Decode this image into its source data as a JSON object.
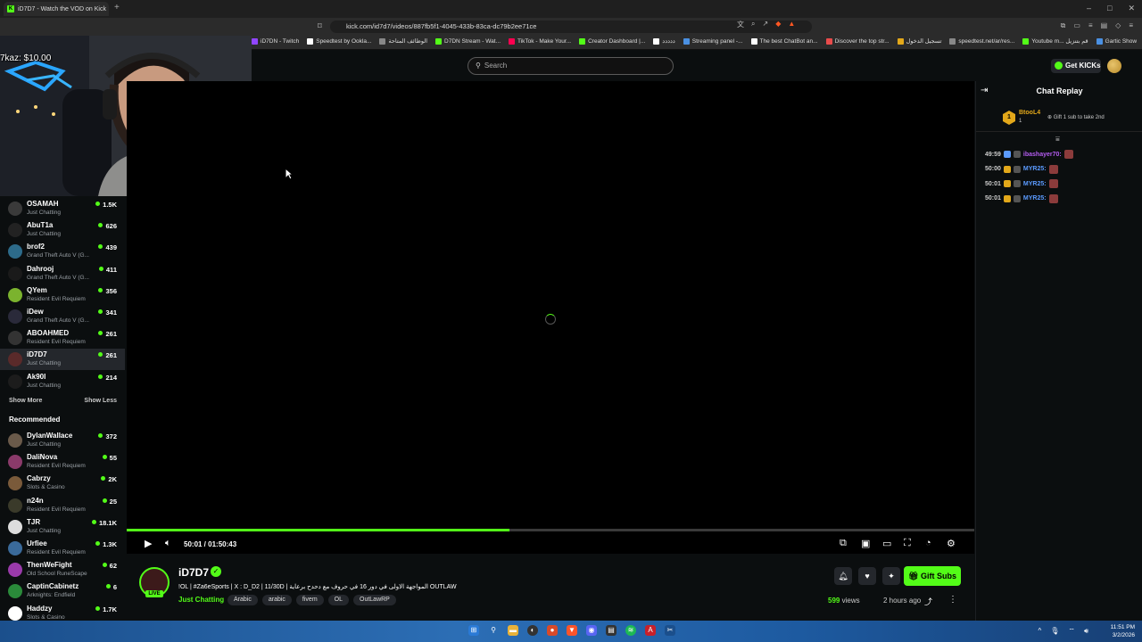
{
  "browser": {
    "tab_title": "iD7D7 - Watch the VOD on Kick",
    "url": "kick.com/id7d7/videos/887fb5f1-4045-433b-83ca-dc79b2ee71ce",
    "bookmarks": [
      {
        "label": "iD7DN - Twitch",
        "color": "#9146ff"
      },
      {
        "label": "Speedtest by Ookla...",
        "color": "#fff"
      },
      {
        "label": "الوظائف المتاحة",
        "color": "#888"
      },
      {
        "label": "D7DN Stream - Wat...",
        "color": "#53fc18"
      },
      {
        "label": "TikTok - Make Your...",
        "color": "#ff0050"
      },
      {
        "label": "Creator Dashboard |...",
        "color": "#53fc18"
      },
      {
        "label": "ددددد",
        "color": "#fff"
      },
      {
        "label": "Streaming panel -...",
        "color": "#4a90e2"
      },
      {
        "label": "The best ChatBot an...",
        "color": "#fff"
      },
      {
        "label": "Discover the top str...",
        "color": "#e94b4b"
      },
      {
        "label": "تسجيل الدخول",
        "color": "#e3a81a"
      },
      {
        "label": "speedtest.net/ar/res...",
        "color": "#888"
      },
      {
        "label": "Youtube m... قم بتنزيل",
        "color": "#53fc18"
      },
      {
        "label": "Gartic Show",
        "color": "#4a90e2"
      }
    ]
  },
  "overlay": {
    "donation_text": "7kaz: $10.00"
  },
  "header": {
    "search_placeholder": "Search",
    "get_kicks_label": "Get KICKs"
  },
  "sidebar": {
    "following": [
      {
        "name": "OSAMAH",
        "category": "Just Chatting",
        "viewers": "1.5K",
        "color": "#3a3a3a"
      },
      {
        "name": "AbuT1a",
        "category": "Just Chatting",
        "viewers": "626",
        "color": "#222"
      },
      {
        "name": "brof2",
        "category": "Grand Theft Auto V (G...",
        "viewers": "439",
        "color": "#2d6b8a"
      },
      {
        "name": "Dahrooj",
        "category": "Grand Theft Auto V (G...",
        "viewers": "411",
        "color": "#1a1a1a"
      },
      {
        "name": "QYem",
        "category": "Resident Evil Requiem",
        "viewers": "356",
        "color": "#7bb32e"
      },
      {
        "name": "iDew",
        "category": "Grand Theft Auto V (G...",
        "viewers": "341",
        "color": "#2a2a3a"
      },
      {
        "name": "ABOAHMED",
        "category": "Resident Evil Requiem",
        "viewers": "261",
        "color": "#333"
      },
      {
        "name": "iD7D7",
        "category": "Just Chatting",
        "viewers": "261",
        "color": "#5a2a2a",
        "active": true
      },
      {
        "name": "Ak90I",
        "category": "Just Chatting",
        "viewers": "214",
        "color": "#1c1c1c"
      }
    ],
    "show_more": "Show More",
    "show_less": "Show Less",
    "recommended_title": "Recommended",
    "recommended": [
      {
        "name": "DylanWallace",
        "category": "Just Chatting",
        "viewers": "372",
        "color": "#6a5a4a"
      },
      {
        "name": "DaliNova",
        "category": "Resident Evil Requiem",
        "viewers": "55",
        "color": "#8a3a6a"
      },
      {
        "name": "Cabrzy",
        "category": "Slots & Casino",
        "viewers": "2K",
        "color": "#7a5a3a"
      },
      {
        "name": "n24n",
        "category": "Resident Evil Requiem",
        "viewers": "25",
        "color": "#3a3a2a"
      },
      {
        "name": "TJR",
        "category": "Just Chatting",
        "viewers": "18.1K",
        "color": "#ddd"
      },
      {
        "name": "Urfiee",
        "category": "Resident Evil Requiem",
        "viewers": "1.3K",
        "color": "#3a6a9a"
      },
      {
        "name": "ThenWeFight",
        "category": "Old School RuneScape",
        "viewers": "62",
        "color": "#9a3aaa"
      },
      {
        "name": "CaptinCabinetz",
        "category": "Arknights: Endfield",
        "viewers": "6",
        "color": "#2a8a3a"
      },
      {
        "name": "Haddzy",
        "category": "Slots & Casino",
        "viewers": "1.7K",
        "color": "#fff"
      }
    ]
  },
  "player": {
    "time": "50:01 / 01:50:43",
    "progress": 0.452
  },
  "stream": {
    "streamer": "iD7D7",
    "live_badge": "LIVE",
    "title": "!OL | #Za6eSports | X : D_D2 | 11/30D | المواجهة الاولى في دور 16 في حروف مع دحدح برعاية OUTLAW",
    "category": "Just Chatting",
    "tags": [
      "Arabic",
      "arabic",
      "fivem",
      "OL",
      "OutLawRP"
    ],
    "gift_label": "Gift Subs",
    "views_count": "599",
    "views_label": "views",
    "ago": "2 hours ago"
  },
  "chat": {
    "title": "Chat Replay",
    "pinned_rank": "1",
    "pinned_user": "BtooL4",
    "pinned_sub": "1",
    "pinned_hint": "Gift 1 sub to take 2nd",
    "messages": [
      {
        "time": "49:59",
        "user": "ibashayer70:",
        "color": "#b45cf0"
      },
      {
        "time": "50:00",
        "user": "MYR25:",
        "color": "#5b9bff"
      },
      {
        "time": "50:01",
        "user": "MYR25:",
        "color": "#5b9bff"
      },
      {
        "time": "50:01",
        "user": "MYR25:",
        "color": "#5b9bff"
      }
    ]
  },
  "taskbar": {
    "time": "11:51 PM",
    "date": "3/2/2026"
  }
}
